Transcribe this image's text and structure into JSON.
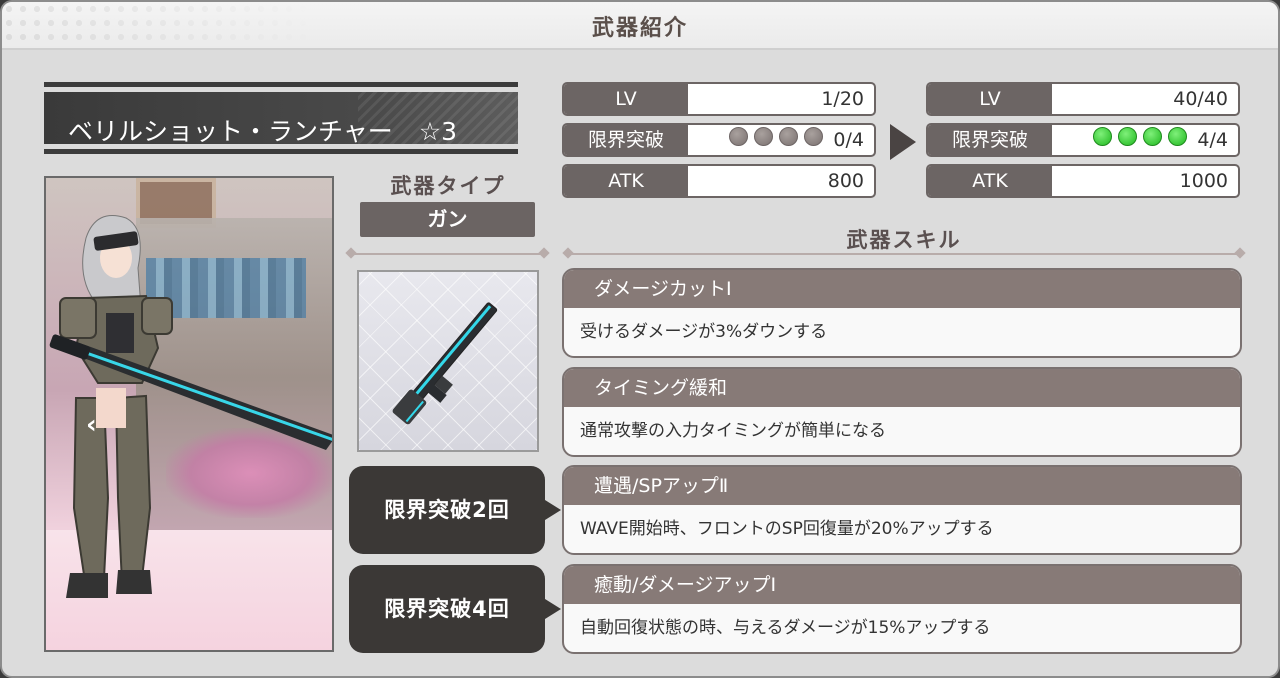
{
  "title": "武器紹介",
  "weapon": {
    "name": "ベリルショット・ランチャー",
    "rarity": "☆3",
    "type_label": "武器タイプ",
    "type_value": "ガン",
    "icon": "rifle-weapon-icon"
  },
  "stats_before": {
    "lv_label": "LV",
    "lv_value": "1/20",
    "limit_label": "限界突破",
    "limit_count": "0/4",
    "limit_filled": 0,
    "limit_total": 4,
    "atk_label": "ATK",
    "atk_value": "800"
  },
  "stats_after": {
    "lv_label": "LV",
    "lv_value": "40/40",
    "limit_label": "限界突破",
    "limit_count": "4/4",
    "limit_filled": 4,
    "limit_total": 4,
    "atk_label": "ATK",
    "atk_value": "1000"
  },
  "skills_title": "武器スキル",
  "skills": [
    {
      "name": "ダメージカットⅠ",
      "desc": "受けるダメージが3%ダウンする"
    },
    {
      "name": "タイミング緩和",
      "desc": "通常攻撃の入力タイミングが簡単になる"
    },
    {
      "name": "遭遇/SPアップⅡ",
      "desc": "WAVE開始時、フロントのSP回復量が20%アップする"
    },
    {
      "name": "癒動/ダメージアップⅠ",
      "desc": "自動回復状態の時、与えるダメージが15%アップする"
    }
  ],
  "limit_break_badges": [
    "限界突破2回",
    "限界突破4回"
  ],
  "portrait_nav": "‹",
  "colors": {
    "accent_dark": "#3b3836",
    "label_bg": "#6c6564",
    "skill_head": "#877a77",
    "dot_on": "#20b81f",
    "dot_off": "#7a7170"
  }
}
